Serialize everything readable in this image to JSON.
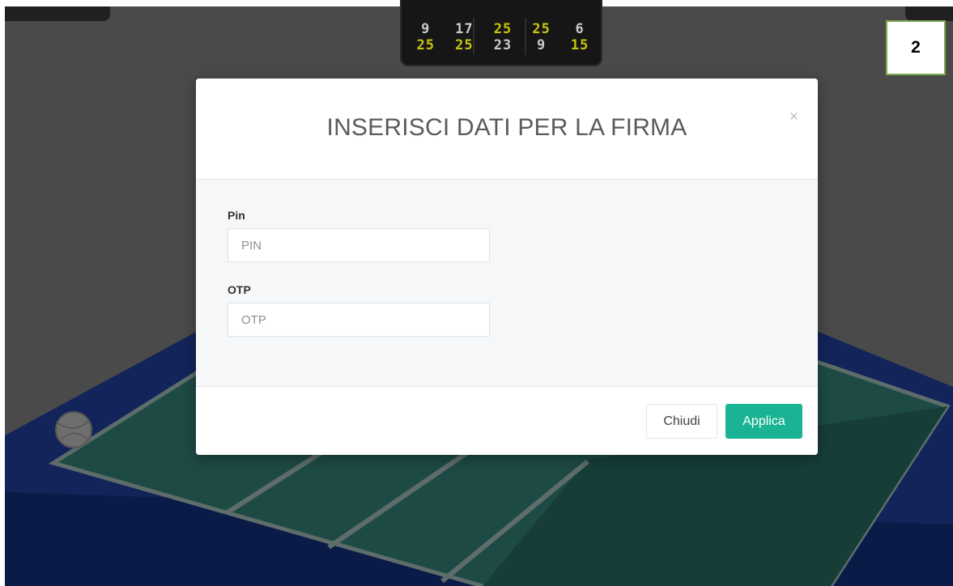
{
  "badge": {
    "number": "2"
  },
  "scoreboard": {
    "row1": [
      "9",
      "17",
      "25",
      "25",
      "6"
    ],
    "row2": [
      "25",
      "25",
      "23",
      "9",
      "15"
    ],
    "row1_colors": [
      "#c9c9c9",
      "#c9c9c9",
      "#c8c40e",
      "#c8c40e",
      "#c9c9c9"
    ],
    "row2_colors": [
      "#c8c40e",
      "#c8c40e",
      "#c9c9c9",
      "#c9c9c9",
      "#c8c40e"
    ]
  },
  "modal": {
    "title": "INSERISCI DATI PER LA FIRMA",
    "close_icon": "×",
    "pin": {
      "label": "Pin",
      "placeholder": "PIN",
      "value": ""
    },
    "otp": {
      "label": "OTP",
      "placeholder": "OTP",
      "value": ""
    },
    "buttons": {
      "close_label": "Chiudi",
      "apply_label": "Applica"
    }
  },
  "colors": {
    "accent": "#1ab394",
    "court_fill": "#1e4a45",
    "court_border": "#0e2a6a",
    "overlay": "#4a4a4a"
  }
}
